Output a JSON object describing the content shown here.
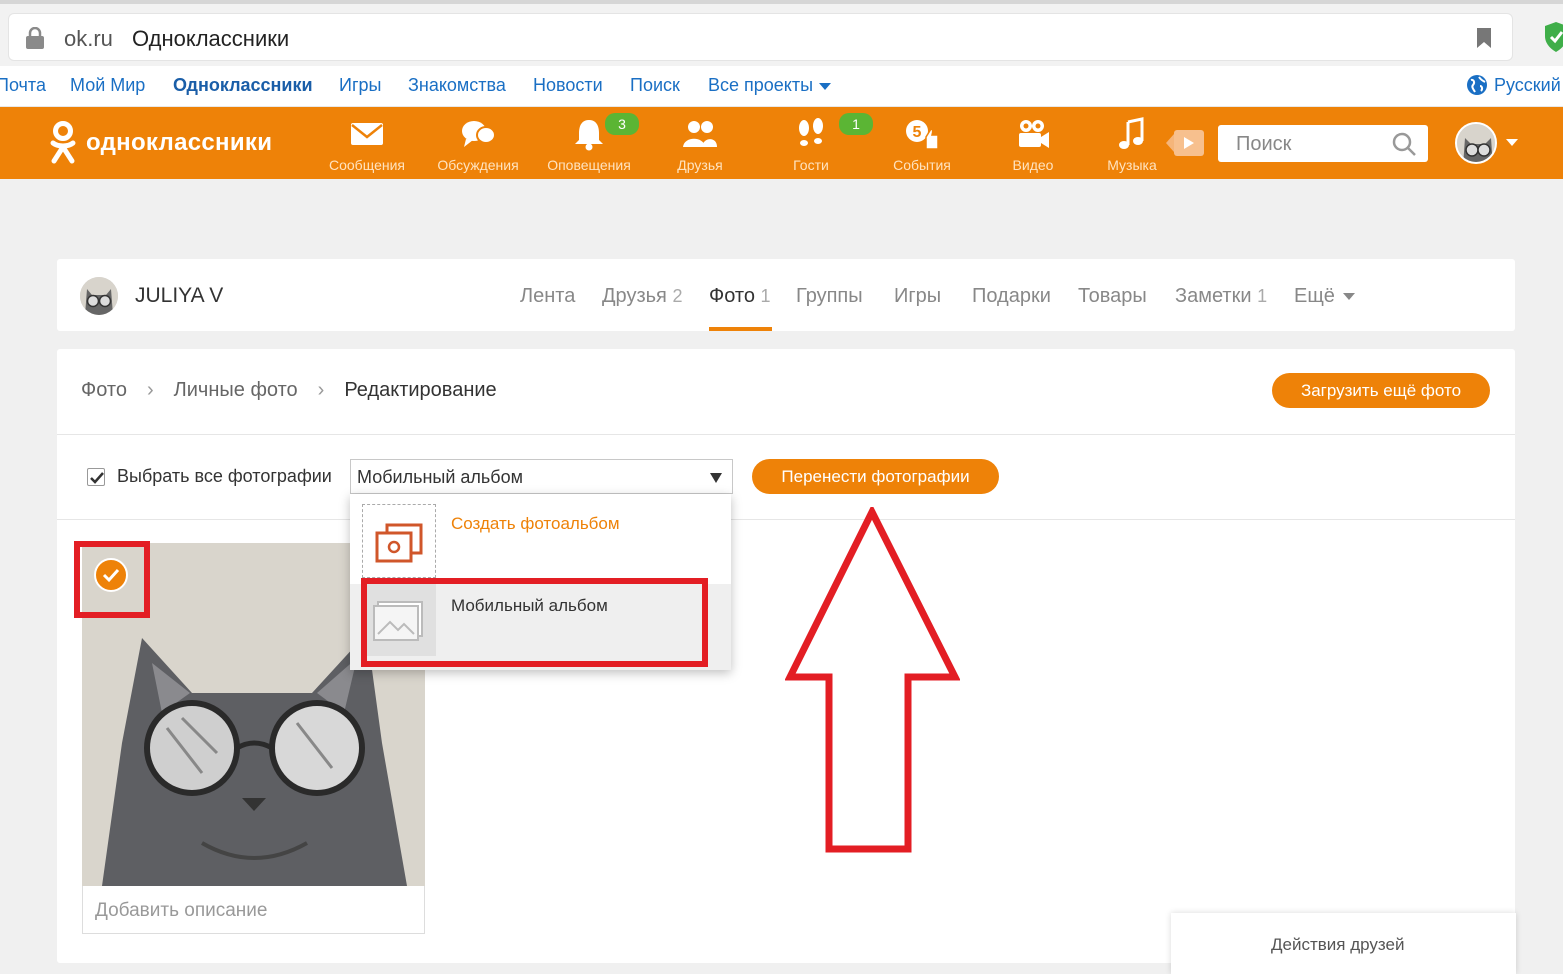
{
  "browser": {
    "domain": "ok.ru",
    "page_title": "Одноклассники"
  },
  "mailru_nav": {
    "items": [
      "Почта",
      "Мой Мир",
      "Одноклассники",
      "Игры",
      "Знакомства",
      "Новости",
      "Поиск",
      "Все проекты"
    ],
    "active": "Одноклассники",
    "language": "Русский"
  },
  "ok_header": {
    "logo_text": "одноклассники",
    "nav": [
      {
        "label": "Сообщения",
        "icon": "envelope-icon"
      },
      {
        "label": "Обсуждения",
        "icon": "chat-bubbles-icon"
      },
      {
        "label": "Оповещения",
        "icon": "bell-icon",
        "badge": "3"
      },
      {
        "label": "Друзья",
        "icon": "friends-icon"
      },
      {
        "label": "Гости",
        "icon": "footprints-icon",
        "badge": "1"
      },
      {
        "label": "События",
        "icon": "events-icon"
      },
      {
        "label": "Видео",
        "icon": "video-camera-icon"
      },
      {
        "label": "Музыка",
        "icon": "music-note-icon"
      }
    ],
    "search_placeholder": "Поиск"
  },
  "profile": {
    "name": "JULIYA V",
    "tabs": [
      {
        "label": "Лента",
        "count": ""
      },
      {
        "label": "Друзья",
        "count": "2"
      },
      {
        "label": "Фото",
        "count": "1"
      },
      {
        "label": "Группы",
        "count": ""
      },
      {
        "label": "Игры",
        "count": ""
      },
      {
        "label": "Подарки",
        "count": ""
      },
      {
        "label": "Товары",
        "count": ""
      },
      {
        "label": "Заметки",
        "count": "1"
      },
      {
        "label": "Ещё",
        "count": ""
      }
    ],
    "active_tab": "Фото"
  },
  "main": {
    "breadcrumbs": [
      "Фото",
      "Личные фото",
      "Редактирование"
    ],
    "upload_button": "Загрузить ещё фото",
    "select_all_label": "Выбрать все фотографии",
    "select_all_checked": true,
    "album_select_value": "Мобильный альбом",
    "move_button": "Перенести фотографии",
    "dropdown": {
      "create_label": "Создать фотоальбом",
      "album_label": "Мобильный альбом"
    },
    "photo_checked": true,
    "description_placeholder": "Добавить описание"
  },
  "friends_panel": {
    "label": "Действия друзей"
  },
  "colors": {
    "ok_orange": "#ee8208",
    "badge_green": "#5bb534",
    "annotation_red": "#e31e24",
    "link_blue": "#1a6fc4"
  }
}
